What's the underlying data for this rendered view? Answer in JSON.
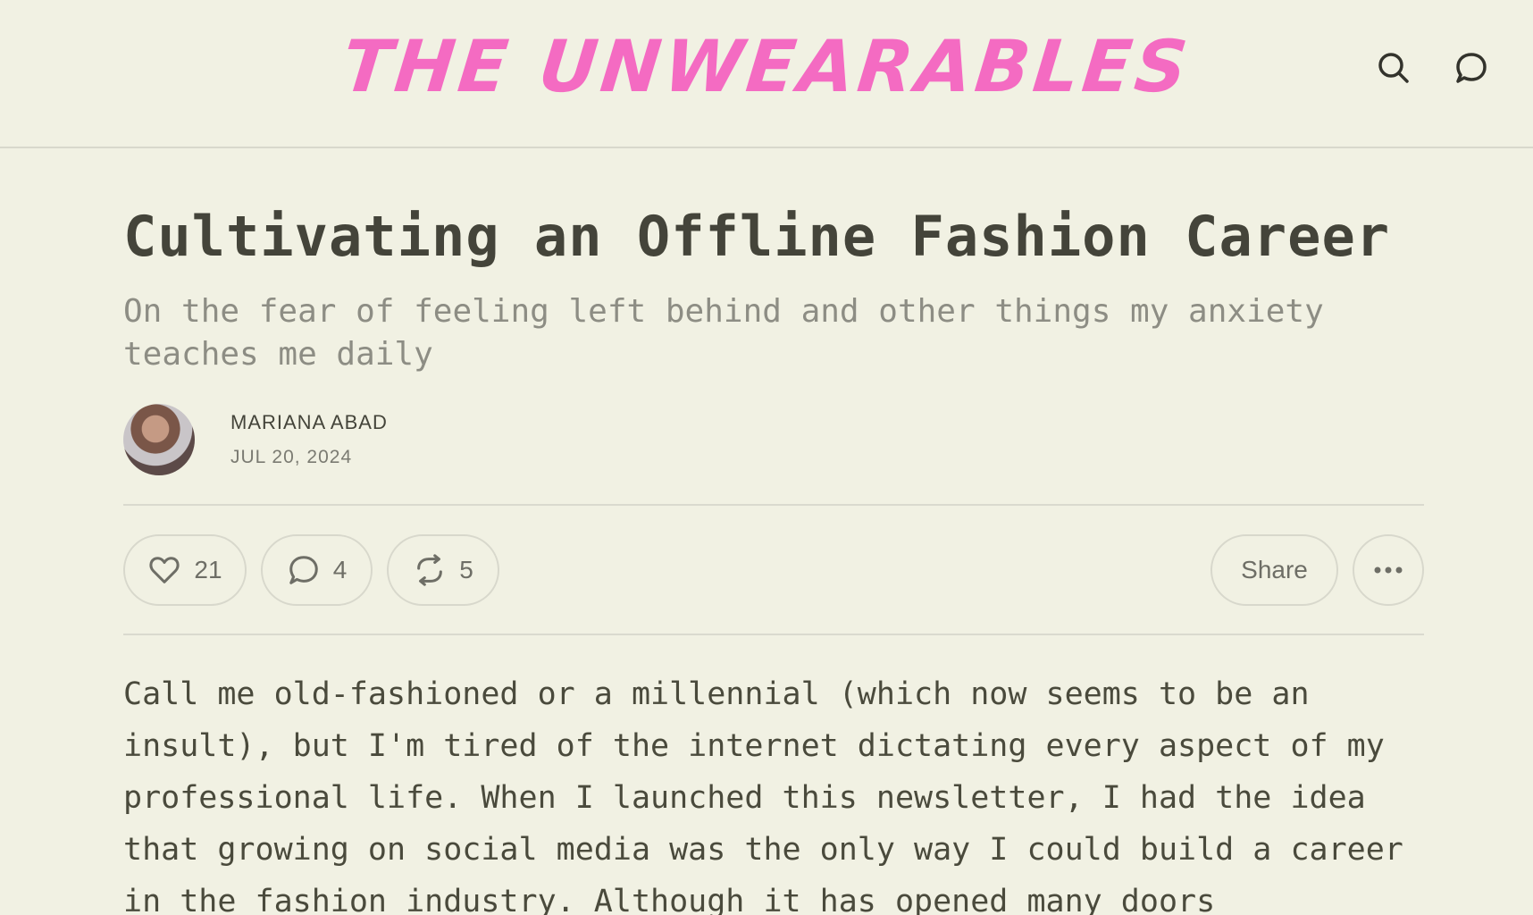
{
  "header": {
    "logo_text": "THE UNWEARABLES",
    "logo_color": "#f46bc2",
    "icons": [
      "search-icon",
      "comment-icon"
    ]
  },
  "post": {
    "title": "Cultivating an Offline Fashion Career",
    "subtitle": "On the fear of feeling left behind and other things my anxiety teaches me daily",
    "author": "MARIANA ABAD",
    "date": "JUL 20, 2024",
    "body": "Call me old-fashioned or a millennial (which now seems to be an insult), but I'm tired of the internet dictating every aspect of my professional life. When I launched this newsletter, I had the idea that growing on social media was the only way I could build a career in the fashion industry. Although it has opened many doors"
  },
  "actions": {
    "likes": "21",
    "comments": "4",
    "restacks": "5",
    "share_label": "Share"
  }
}
